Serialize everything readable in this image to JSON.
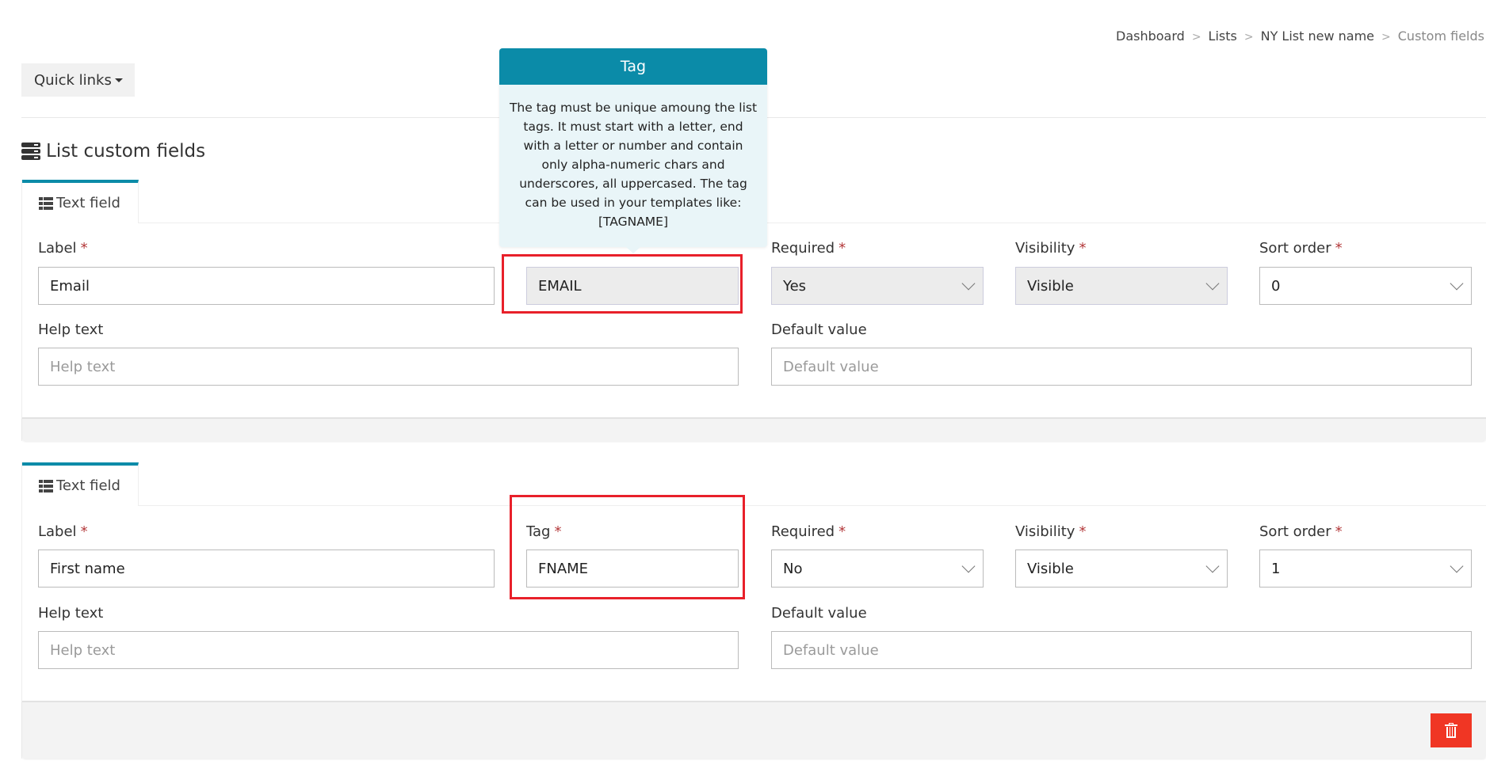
{
  "breadcrumb": {
    "items": [
      "Dashboard",
      "Lists",
      "NY List new name",
      "Custom fields"
    ],
    "separator": ">"
  },
  "quick_links": {
    "label": "Quick links"
  },
  "page_title": "List custom fields",
  "tooltip": {
    "title": "Tag",
    "body": "The tag must be unique amoung the list tags. It must start with a letter, end with a letter or number and contain only alpha-numeric chars and underscores, all uppercased. The tag can be used in your templates like: [TAGNAME]"
  },
  "labels": {
    "label": "Label",
    "tag": "Tag",
    "required": "Required",
    "visibility": "Visibility",
    "sort_order": "Sort order",
    "help_text": "Help text",
    "default_value": "Default value",
    "required_marker": "*"
  },
  "fields": [
    {
      "type": "Text field",
      "label_value": "Email",
      "tag_value": "EMAIL",
      "tag_disabled": true,
      "required_value": "Yes",
      "visibility_value": "Visible",
      "sort_order_value": "0",
      "help_text_placeholder": "Help text",
      "default_value_placeholder": "Default value"
    },
    {
      "type": "Text field",
      "label_value": "First name",
      "tag_value": "FNAME",
      "tag_disabled": false,
      "required_value": "No",
      "visibility_value": "Visible",
      "sort_order_value": "1",
      "help_text_placeholder": "Help text",
      "default_value_placeholder": "Default value"
    }
  ],
  "colors": {
    "accent": "#0b8ba8",
    "highlight": "#e8202a",
    "danger": "#f03624",
    "required_marker": "#b3383a",
    "tooltip_bg": "#e9f5f8"
  }
}
